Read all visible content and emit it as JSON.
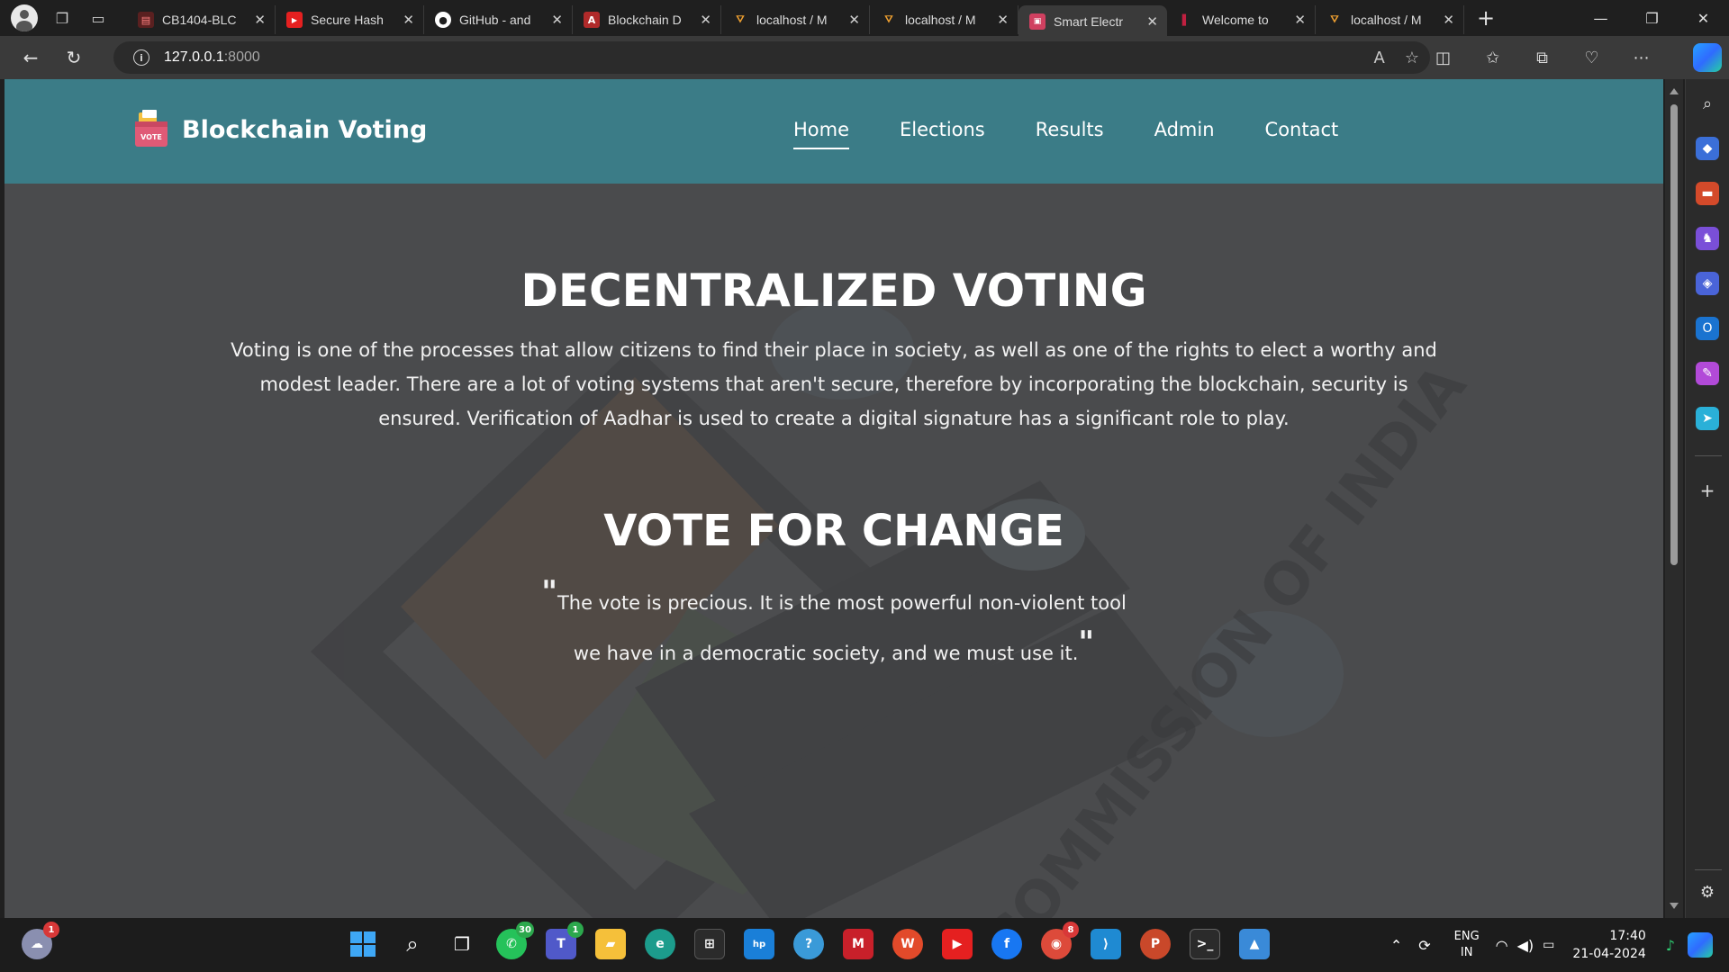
{
  "browser": {
    "tabs": [
      {
        "title": "CB1404-BLC",
        "favicon": "pdf-icon",
        "active": false
      },
      {
        "title": "Secure Hash",
        "favicon": "youtube-icon",
        "active": false
      },
      {
        "title": "GitHub - and",
        "favicon": "github-icon",
        "active": false
      },
      {
        "title": "Blockchain D",
        "favicon": "document-icon",
        "active": false
      },
      {
        "title": "localhost / M",
        "favicon": "phpmyadmin-icon",
        "active": false
      },
      {
        "title": "localhost / M",
        "favicon": "phpmyadmin-icon",
        "active": false
      },
      {
        "title": "Smart Electr",
        "favicon": "ballot-icon",
        "active": true
      },
      {
        "title": "Welcome to",
        "favicon": "page-icon",
        "active": false
      },
      {
        "title": "localhost / M",
        "favicon": "phpmyadmin-icon",
        "active": false
      }
    ],
    "address": {
      "host": "127.0.0.1",
      "port": ":8000"
    }
  },
  "site": {
    "brand": "Blockchain Voting",
    "logo_label": "VOTE",
    "nav": [
      "Home",
      "Elections",
      "Results",
      "Admin",
      "Contact"
    ],
    "active_nav": "Home",
    "hero": {
      "title": "DECENTRALIZED VOTING",
      "paragraph": "Voting is one of the processes that allow citizens to find their place in society, as well as one of the rights to elect a worthy and modest leader. There are a lot of voting systems that aren't secure, therefore by incorporating the blockchain, security is ensured. Verification of Aadhar is used to create a digital signature has a significant role to play.",
      "subtitle": "VOTE FOR CHANGE",
      "quote": "The vote is precious. It is the most powerful non-violent tool we have in a democratic society, and we must use it.",
      "background_text": "COMMISSION OF INDIA"
    }
  },
  "taskbar": {
    "weather_badge": "1",
    "whatsapp_badge": "30",
    "teams_badge": "1",
    "chrome_badge": "8",
    "lang_top": "ENG",
    "lang_bottom": "IN",
    "time": "17:40",
    "date": "21-04-2024"
  },
  "colors": {
    "header": "#3b7c87",
    "hero_overlay": "#4a4b4d",
    "browser_dark": "#1f1f1f"
  }
}
